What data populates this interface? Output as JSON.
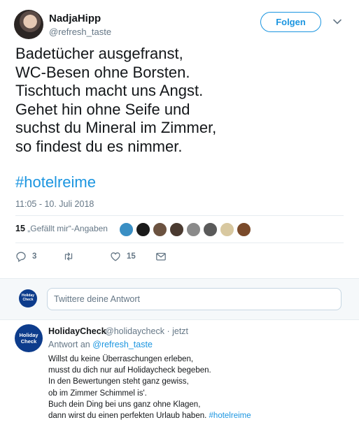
{
  "tweet": {
    "author_name": "NadjaHipp",
    "author_handle": "@refresh_taste",
    "follow_label": "Folgen",
    "text": "Badetücher ausgefranst,\nWC-Besen ohne Borsten.\nTischtuch macht uns Angst.\nGehet hin ohne Seife und\nsuchst du Mineral im Zimmer,\nso findest du es nimmer.",
    "hashtag": "#hotelreime",
    "timestamp": "11:05 - 10. Juli 2018",
    "likes_count": "15",
    "likes_label": "„Gefällt mir“-Angaben",
    "liker_avatars": [
      "#3a8fc4",
      "#1a1a1a",
      "#6b5240",
      "#4a3a30",
      "#8a8a8a",
      "#5a5a5a",
      "#d8c8a0",
      "#7a4a2a"
    ],
    "actions": {
      "reply_icon": "reply-icon",
      "reply_count": "3",
      "retweet_icon": "retweet-icon",
      "like_icon": "heart-icon",
      "like_count": "15",
      "dm_icon": "envelope-icon"
    }
  },
  "reply_box": {
    "logo_text_top": "Holiday",
    "logo_text_bottom": "Check",
    "placeholder": "Twittere deine Antwort"
  },
  "reply": {
    "author_name": "HolidayCheck",
    "author_handle": "@holidaycheck",
    "time": "· jetzt",
    "reply_to_prefix": "Antwort an",
    "reply_to_handle": "@refresh_taste",
    "logo_text_top": "Holiday",
    "logo_text_bottom": "Check",
    "body": "Willst du keine Überraschungen erleben,\nmusst du dich nur auf Holidaycheck begeben.\nIn den Bewertungen steht ganz gewiss,\nob im Zimmer Schimmel is'.\nBuch dein Ding bei uns ganz ohne Klagen,\ndann wirst du einen perfekten Urlaub haben.",
    "hashtag": "#hotelreime"
  },
  "colors": {
    "accent": "#1b95e0",
    "muted": "#657786",
    "brand_holidaycheck": "#0d3c8c"
  }
}
